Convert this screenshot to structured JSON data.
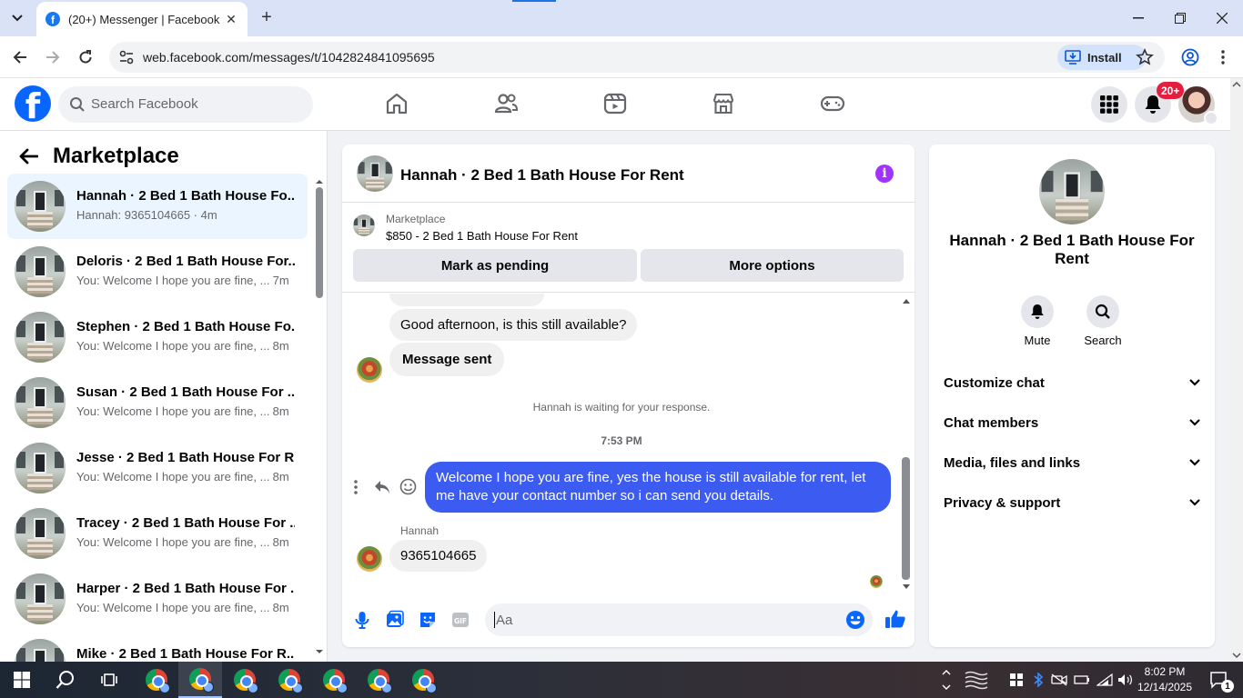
{
  "browser": {
    "tab_title": "(20+) Messenger | Facebook",
    "url": "web.facebook.com/messages/t/1042824841095695",
    "install_label": "Install"
  },
  "facebook": {
    "search_placeholder": "Search Facebook",
    "notification_badge": "20+",
    "nav_icons": [
      "home-icon",
      "friends-icon",
      "video-icon",
      "marketplace-icon",
      "gaming-icon"
    ]
  },
  "left_pane": {
    "title": "Marketplace",
    "chats": [
      {
        "name": "Hannah · 2 Bed 1 Bath House Fo...",
        "preview": "Hannah: 9365104665",
        "time": "4m",
        "active": true
      },
      {
        "name": "Deloris · 2 Bed 1 Bath House For...",
        "preview": "You: Welcome I hope you are fine, ...",
        "time": "7m"
      },
      {
        "name": "Stephen · 2 Bed 1 Bath House Fo...",
        "preview": "You: Welcome I hope you are fine, ...",
        "time": "8m"
      },
      {
        "name": "Susan · 2 Bed 1 Bath House For ...",
        "preview": "You: Welcome I hope you are fine, ...",
        "time": "8m"
      },
      {
        "name": "Jesse · 2 Bed 1 Bath House For R...",
        "preview": "You: Welcome I hope you are fine, ...",
        "time": "8m"
      },
      {
        "name": "Tracey · 2 Bed 1 Bath House For ...",
        "preview": "You: Welcome I hope you are fine, ...",
        "time": "8m"
      },
      {
        "name": "Harper · 2 Bed 1 Bath House For ...",
        "preview": "You: Welcome I hope you are fine, ...",
        "time": "8m"
      },
      {
        "name": "Mike · 2 Bed 1 Bath House For R...",
        "preview": "",
        "time": ""
      }
    ]
  },
  "conversation": {
    "title": "Hannah · 2 Bed 1 Bath House For Rent",
    "marketplace_label": "Marketplace",
    "listing": "$850 - 2 Bed 1 Bath House For Rent",
    "mark_pending": "Mark as pending",
    "more_options": "More options",
    "messages": {
      "in1": "Good afternoon, is this still available?",
      "in2": "Message sent",
      "waiting": "Hannah is waiting for your response.",
      "timestamp": "7:53 PM",
      "out1": "Welcome I hope you are fine, yes the house is still available for rent, let me have your contact number so i can send you  details.",
      "sender": "Hannah",
      "in3": "9365104665"
    },
    "composer_placeholder": "Aa"
  },
  "right_panel": {
    "name": "Hannah · 2 Bed 1 Bath House For Rent",
    "mute": "Mute",
    "search": "Search",
    "sections": [
      "Customize chat",
      "Chat members",
      "Media, files and links",
      "Privacy & support"
    ]
  },
  "taskbar": {
    "time": "8:02 PM",
    "date": "12/14/2025",
    "notification_count": "1"
  },
  "colors": {
    "fb_blue": "#0866ff",
    "outgoing_bubble": "#3c5bf0",
    "badge_red": "#e41e3f",
    "info_purple": "#a033ff"
  }
}
